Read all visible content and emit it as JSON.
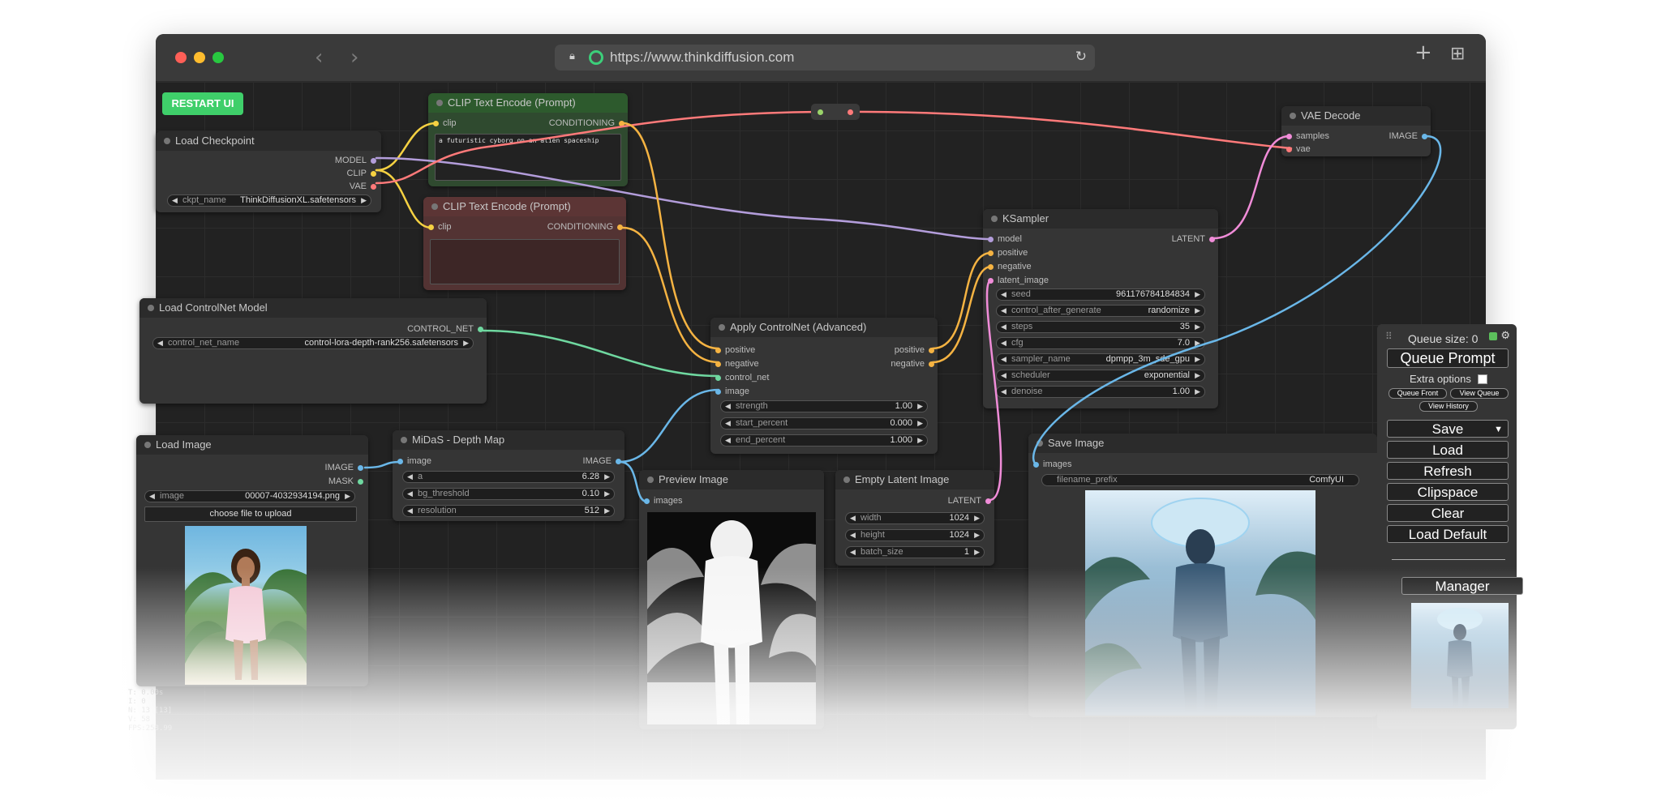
{
  "browser": {
    "url": "https://www.thinkdiffusion.com",
    "back_icon": "‹",
    "forward_icon": "›",
    "reload_icon": "↻",
    "new_tab_icon": "+",
    "tabs_icon": "⊞"
  },
  "restart_label": "RESTART UI",
  "stats": [
    "T: 0.00s",
    "I: 0",
    "N: 13 [13]",
    "V: 58",
    "FPS:258.99"
  ],
  "nodes": {
    "load_checkpoint": {
      "title": "Load Checkpoint",
      "outputs": [
        "MODEL",
        "CLIP",
        "VAE"
      ],
      "ckpt_label": "ckpt_name",
      "ckpt_value": "ThinkDiffusionXL.safetensors"
    },
    "clip_pos": {
      "title": "CLIP Text Encode (Prompt)",
      "input": "clip",
      "output": "CONDITIONING",
      "text": "a futuristic cyborg on an alien spaceship"
    },
    "clip_neg": {
      "title": "CLIP Text Encode (Prompt)",
      "input": "clip",
      "output": "CONDITIONING",
      "text": ""
    },
    "load_controlnet": {
      "title": "Load ControlNet Model",
      "output": "CONTROL_NET",
      "label": "control_net_name",
      "value": "control-lora-depth-rank256.safetensors"
    },
    "apply_controlnet": {
      "title": "Apply ControlNet (Advanced)",
      "inputs": [
        "positive",
        "negative",
        "control_net",
        "image"
      ],
      "outputs": [
        "positive",
        "negative"
      ],
      "widgets": [
        {
          "label": "strength",
          "value": "1.00"
        },
        {
          "label": "start_percent",
          "value": "0.000"
        },
        {
          "label": "end_percent",
          "value": "1.000"
        }
      ]
    },
    "ksampler": {
      "title": "KSampler",
      "inputs": [
        "model",
        "positive",
        "negative",
        "latent_image"
      ],
      "output": "LATENT",
      "widgets": [
        {
          "label": "seed",
          "value": "961176784184834"
        },
        {
          "label": "control_after_generate",
          "value": "randomize"
        },
        {
          "label": "steps",
          "value": "35"
        },
        {
          "label": "cfg",
          "value": "7.0"
        },
        {
          "label": "sampler_name",
          "value": "dpmpp_3m_sde_gpu"
        },
        {
          "label": "scheduler",
          "value": "exponential"
        },
        {
          "label": "denoise",
          "value": "1.00"
        }
      ]
    },
    "vae_decode": {
      "title": "VAE Decode",
      "inputs": [
        "samples",
        "vae"
      ],
      "output": "IMAGE"
    },
    "load_image": {
      "title": "Load Image",
      "outputs": [
        "IMAGE",
        "MASK"
      ],
      "image_label": "image",
      "image_value": "00007-4032934194.png",
      "upload_label": "choose file to upload"
    },
    "midas": {
      "title": "MiDaS - Depth Map",
      "input": "image",
      "output": "IMAGE",
      "widgets": [
        {
          "label": "a",
          "value": "6.28"
        },
        {
          "label": "bg_threshold",
          "value": "0.10"
        },
        {
          "label": "resolution",
          "value": "512"
        }
      ]
    },
    "preview_image": {
      "title": "Preview Image",
      "input": "images"
    },
    "empty_latent": {
      "title": "Empty Latent Image",
      "output": "LATENT",
      "widgets": [
        {
          "label": "width",
          "value": "1024"
        },
        {
          "label": "height",
          "value": "1024"
        },
        {
          "label": "batch_size",
          "value": "1"
        }
      ]
    },
    "save_image": {
      "title": "Save Image",
      "input": "images",
      "prefix_label": "filename_prefix",
      "prefix_value": "ComfyUI"
    }
  },
  "menu": {
    "queue_size": "Queue size: 0",
    "queue_prompt": "Queue Prompt",
    "extra_options": "Extra options",
    "queue_front": "Queue Front",
    "view_queue": "View Queue",
    "view_history": "View History",
    "save": "Save",
    "load": "Load",
    "refresh": "Refresh",
    "clipspace": "Clipspace",
    "clear": "Clear",
    "load_default": "Load Default",
    "manager": "Manager"
  },
  "colors": {
    "model": "#b39ddb",
    "clip": "#f5d142",
    "vae": "#ff7a7a",
    "conditioning": "#f5b342",
    "control_net": "#6fd8a0",
    "image": "#6ab7e8",
    "latent": "#f08cd8",
    "restart": "#3fcf6a"
  }
}
